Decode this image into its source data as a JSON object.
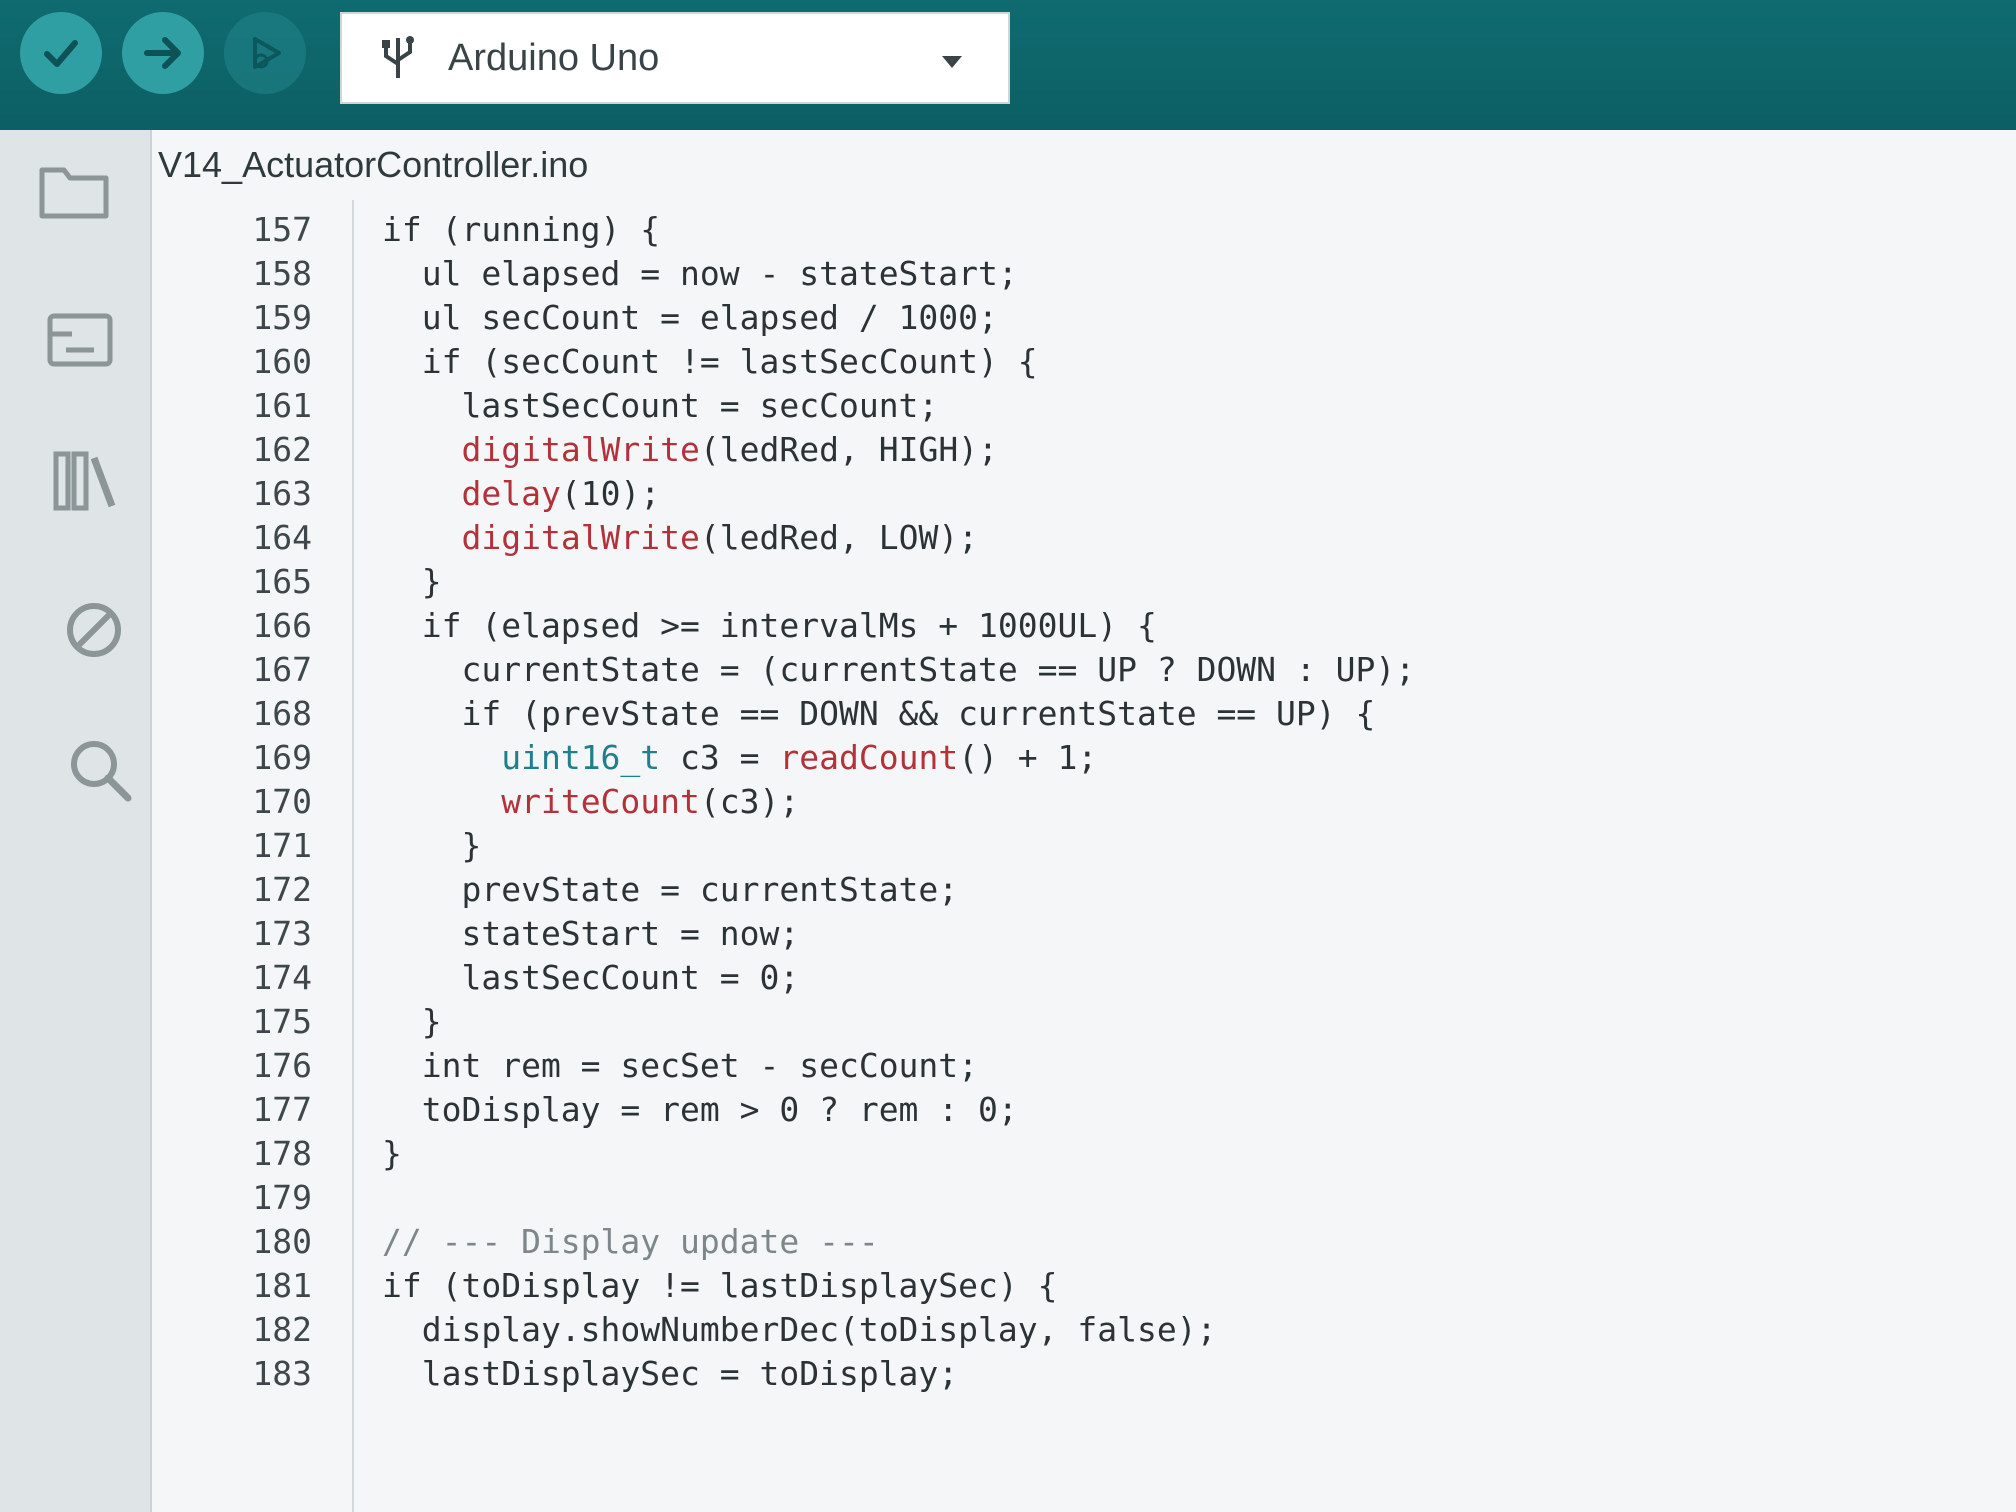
{
  "toolbar": {
    "board_name": "Arduino Uno",
    "icons": [
      "verify-check-icon",
      "upload-arrow-icon",
      "debug-icon",
      "usb-icon",
      "chevron-down-icon"
    ]
  },
  "sidebar": {
    "icons": [
      "folder-icon",
      "board-manager-icon",
      "library-icon",
      "debug-stop-icon",
      "search-icon"
    ]
  },
  "editor": {
    "file_name": "V14_ActuatorController.ino",
    "lines": [
      {
        "num": "157",
        "code": "if (running) {"
      },
      {
        "num": "158",
        "code": "  ul elapsed = now - stateStart;"
      },
      {
        "num": "159",
        "code": "  ul secCount = elapsed / 1000;"
      },
      {
        "num": "160",
        "code": "  if (secCount != lastSecCount) {"
      },
      {
        "num": "161",
        "code": "    lastSecCount = secCount;"
      },
      {
        "num": "162",
        "code": "    digitalWrite(ledRed, HIGH);"
      },
      {
        "num": "163",
        "code": "    delay(10);"
      },
      {
        "num": "164",
        "code": "    digitalWrite(ledRed, LOW);"
      },
      {
        "num": "165",
        "code": "  }"
      },
      {
        "num": "166",
        "code": "  if (elapsed >= intervalMs + 1000UL) {"
      },
      {
        "num": "167",
        "code": "    currentState = (currentState == UP ? DOWN : UP);"
      },
      {
        "num": "168",
        "code": "    if (prevState == DOWN && currentState == UP) {"
      },
      {
        "num": "169",
        "code": "      uint16_t c3 = readCount() + 1;"
      },
      {
        "num": "170",
        "code": "      writeCount(c3);"
      },
      {
        "num": "171",
        "code": "    }"
      },
      {
        "num": "172",
        "code": "    prevState = currentState;"
      },
      {
        "num": "173",
        "code": "    stateStart = now;"
      },
      {
        "num": "174",
        "code": "    lastSecCount = 0;"
      },
      {
        "num": "175",
        "code": "  }"
      },
      {
        "num": "176",
        "code": "  int rem = secSet - secCount;"
      },
      {
        "num": "177",
        "code": "  toDisplay = rem > 0 ? rem : 0;"
      },
      {
        "num": "178",
        "code": "}"
      },
      {
        "num": "179",
        "code": ""
      },
      {
        "num": "180",
        "code": "// --- Display update ---"
      },
      {
        "num": "181",
        "code": "if (toDisplay != lastDisplaySec) {"
      },
      {
        "num": "182",
        "code": "  display.showNumberDec(toDisplay, false);"
      },
      {
        "num": "183",
        "code": "  lastDisplaySec = toDisplay;"
      }
    ]
  },
  "colors": {
    "toolbar": "#0f6b70",
    "function": "#b3323a",
    "type": "#1f7f8a",
    "comment": "#7d8789"
  }
}
